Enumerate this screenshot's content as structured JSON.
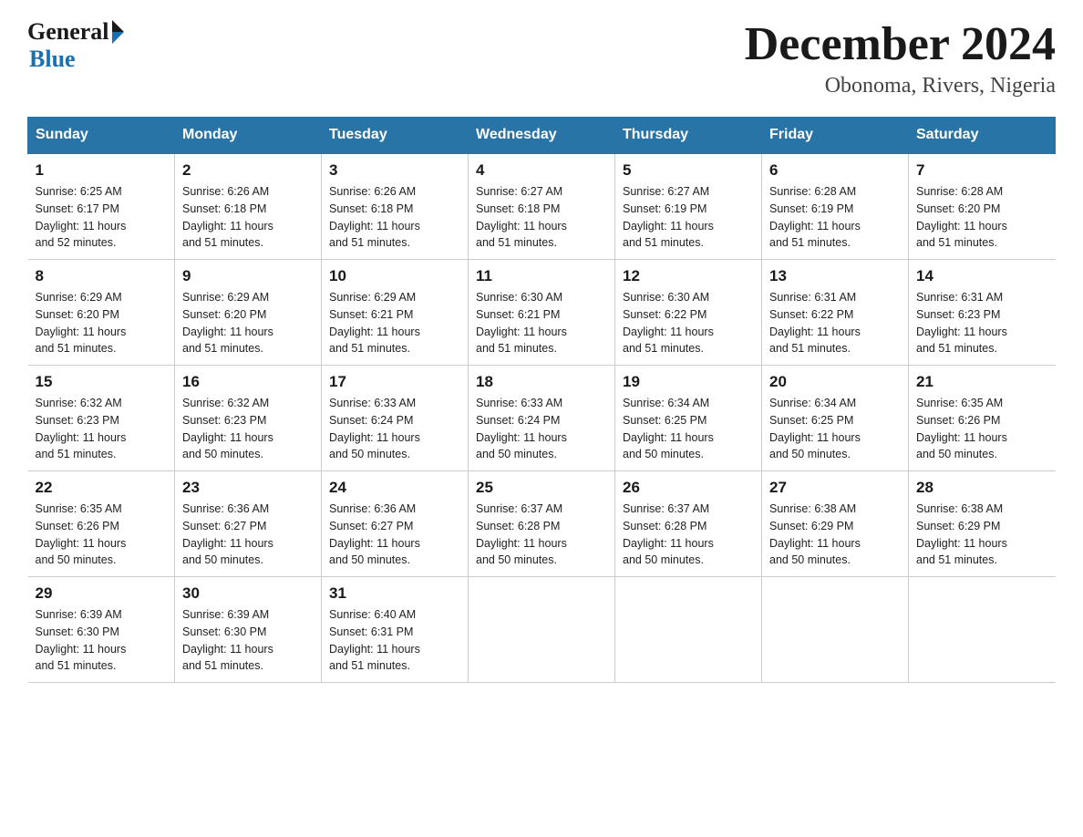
{
  "logo": {
    "general": "General",
    "blue": "Blue",
    "arrow": "▶"
  },
  "title": "December 2024",
  "subtitle": "Obonoma, Rivers, Nigeria",
  "weekdays": [
    "Sunday",
    "Monday",
    "Tuesday",
    "Wednesday",
    "Thursday",
    "Friday",
    "Saturday"
  ],
  "weeks": [
    [
      {
        "day": "1",
        "sunrise": "6:25 AM",
        "sunset": "6:17 PM",
        "daylight": "11 hours and 52 minutes."
      },
      {
        "day": "2",
        "sunrise": "6:26 AM",
        "sunset": "6:18 PM",
        "daylight": "11 hours and 51 minutes."
      },
      {
        "day": "3",
        "sunrise": "6:26 AM",
        "sunset": "6:18 PM",
        "daylight": "11 hours and 51 minutes."
      },
      {
        "day": "4",
        "sunrise": "6:27 AM",
        "sunset": "6:18 PM",
        "daylight": "11 hours and 51 minutes."
      },
      {
        "day": "5",
        "sunrise": "6:27 AM",
        "sunset": "6:19 PM",
        "daylight": "11 hours and 51 minutes."
      },
      {
        "day": "6",
        "sunrise": "6:28 AM",
        "sunset": "6:19 PM",
        "daylight": "11 hours and 51 minutes."
      },
      {
        "day": "7",
        "sunrise": "6:28 AM",
        "sunset": "6:20 PM",
        "daylight": "11 hours and 51 minutes."
      }
    ],
    [
      {
        "day": "8",
        "sunrise": "6:29 AM",
        "sunset": "6:20 PM",
        "daylight": "11 hours and 51 minutes."
      },
      {
        "day": "9",
        "sunrise": "6:29 AM",
        "sunset": "6:20 PM",
        "daylight": "11 hours and 51 minutes."
      },
      {
        "day": "10",
        "sunrise": "6:29 AM",
        "sunset": "6:21 PM",
        "daylight": "11 hours and 51 minutes."
      },
      {
        "day": "11",
        "sunrise": "6:30 AM",
        "sunset": "6:21 PM",
        "daylight": "11 hours and 51 minutes."
      },
      {
        "day": "12",
        "sunrise": "6:30 AM",
        "sunset": "6:22 PM",
        "daylight": "11 hours and 51 minutes."
      },
      {
        "day": "13",
        "sunrise": "6:31 AM",
        "sunset": "6:22 PM",
        "daylight": "11 hours and 51 minutes."
      },
      {
        "day": "14",
        "sunrise": "6:31 AM",
        "sunset": "6:23 PM",
        "daylight": "11 hours and 51 minutes."
      }
    ],
    [
      {
        "day": "15",
        "sunrise": "6:32 AM",
        "sunset": "6:23 PM",
        "daylight": "11 hours and 51 minutes."
      },
      {
        "day": "16",
        "sunrise": "6:32 AM",
        "sunset": "6:23 PM",
        "daylight": "11 hours and 50 minutes."
      },
      {
        "day": "17",
        "sunrise": "6:33 AM",
        "sunset": "6:24 PM",
        "daylight": "11 hours and 50 minutes."
      },
      {
        "day": "18",
        "sunrise": "6:33 AM",
        "sunset": "6:24 PM",
        "daylight": "11 hours and 50 minutes."
      },
      {
        "day": "19",
        "sunrise": "6:34 AM",
        "sunset": "6:25 PM",
        "daylight": "11 hours and 50 minutes."
      },
      {
        "day": "20",
        "sunrise": "6:34 AM",
        "sunset": "6:25 PM",
        "daylight": "11 hours and 50 minutes."
      },
      {
        "day": "21",
        "sunrise": "6:35 AM",
        "sunset": "6:26 PM",
        "daylight": "11 hours and 50 minutes."
      }
    ],
    [
      {
        "day": "22",
        "sunrise": "6:35 AM",
        "sunset": "6:26 PM",
        "daylight": "11 hours and 50 minutes."
      },
      {
        "day": "23",
        "sunrise": "6:36 AM",
        "sunset": "6:27 PM",
        "daylight": "11 hours and 50 minutes."
      },
      {
        "day": "24",
        "sunrise": "6:36 AM",
        "sunset": "6:27 PM",
        "daylight": "11 hours and 50 minutes."
      },
      {
        "day": "25",
        "sunrise": "6:37 AM",
        "sunset": "6:28 PM",
        "daylight": "11 hours and 50 minutes."
      },
      {
        "day": "26",
        "sunrise": "6:37 AM",
        "sunset": "6:28 PM",
        "daylight": "11 hours and 50 minutes."
      },
      {
        "day": "27",
        "sunrise": "6:38 AM",
        "sunset": "6:29 PM",
        "daylight": "11 hours and 50 minutes."
      },
      {
        "day": "28",
        "sunrise": "6:38 AM",
        "sunset": "6:29 PM",
        "daylight": "11 hours and 51 minutes."
      }
    ],
    [
      {
        "day": "29",
        "sunrise": "6:39 AM",
        "sunset": "6:30 PM",
        "daylight": "11 hours and 51 minutes."
      },
      {
        "day": "30",
        "sunrise": "6:39 AM",
        "sunset": "6:30 PM",
        "daylight": "11 hours and 51 minutes."
      },
      {
        "day": "31",
        "sunrise": "6:40 AM",
        "sunset": "6:31 PM",
        "daylight": "11 hours and 51 minutes."
      },
      null,
      null,
      null,
      null
    ]
  ],
  "labels": {
    "sunrise": "Sunrise:",
    "sunset": "Sunset:",
    "daylight": "Daylight:"
  }
}
